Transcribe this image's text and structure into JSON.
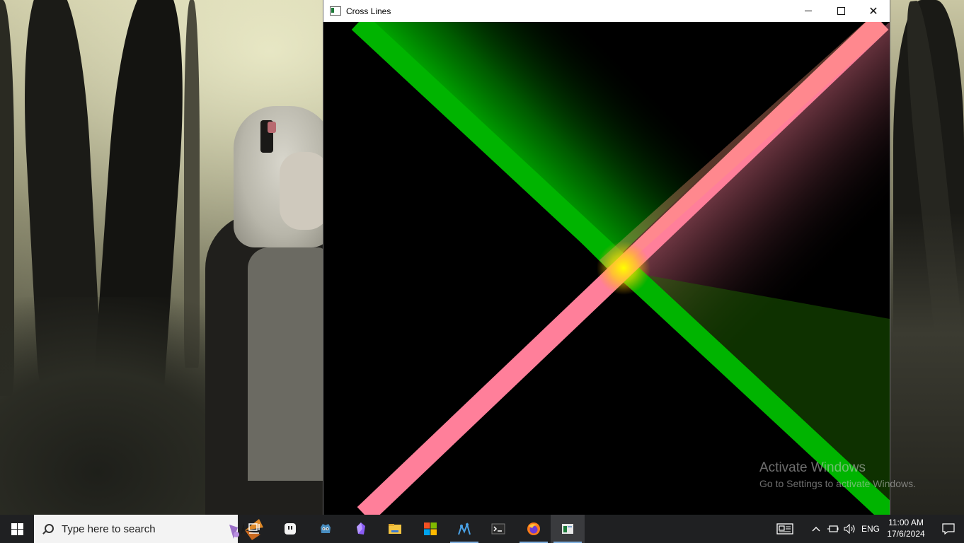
{
  "window": {
    "title": "Cross Lines",
    "minimize_icon": "minimize-icon",
    "maximize_icon": "maximize-icon",
    "close_icon": "close-icon",
    "close_glyph": "✕"
  },
  "canvas": {
    "background_color": "#000000",
    "line_colors": {
      "green": "#00c400",
      "pink": "#ff7f9a",
      "intersection": "#ffff00"
    }
  },
  "watermark": {
    "line1": "Activate Windows",
    "line2": "Go to Settings to activate Windows."
  },
  "taskbar": {
    "search_placeholder": "Type here to search",
    "apps": [
      {
        "name": "task-view",
        "icon": "task-view-icon"
      },
      {
        "name": "app-2",
        "icon": "chat-bubble-icon"
      },
      {
        "name": "godot",
        "icon": "godot-icon"
      },
      {
        "name": "obsidian",
        "icon": "obsidian-icon"
      },
      {
        "name": "file-explorer",
        "icon": "folder-icon"
      },
      {
        "name": "store",
        "icon": "store-icon"
      },
      {
        "name": "vs-app",
        "icon": "app-tree-icon"
      },
      {
        "name": "terminal",
        "icon": "terminal-icon"
      },
      {
        "name": "firefox",
        "icon": "firefox-icon"
      },
      {
        "name": "cross-lines",
        "icon": "window-app-icon"
      }
    ],
    "tray": {
      "language": "ENG",
      "time": "11:00 AM",
      "date": "17/6/2024"
    }
  }
}
